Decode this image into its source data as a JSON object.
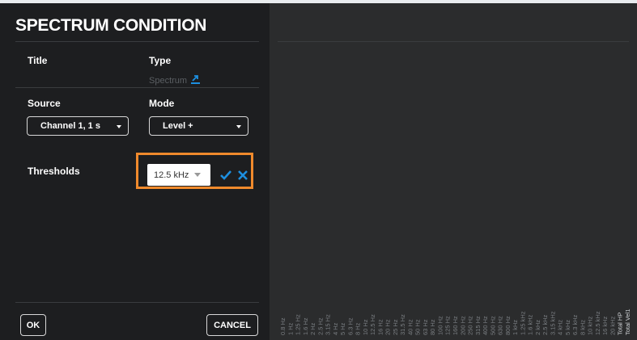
{
  "panel": {
    "title": "SPECTRUM CONDITION",
    "title_label": "Title",
    "type_label": "Type",
    "type_value": "Spectrum",
    "source_label": "Source",
    "mode_label": "Mode",
    "source_value": "Channel 1, 1 s",
    "mode_value": "Level +",
    "thresholds_label": "Thresholds",
    "threshold_value": "12.5 kHz",
    "ok_label": "OK",
    "cancel_label": "CANCEL"
  },
  "colors": {
    "highlight": "#f08a2c",
    "accent": "#1d8fe0",
    "panel_bg": "#1d1e20",
    "chart_bg": "#2b2c2d"
  },
  "icons": {
    "type_link": "external-link-icon",
    "confirm": "check-icon",
    "clear": "x-icon"
  },
  "chart": {
    "freq_labels": [
      "0.8 Hz",
      "1 Hz",
      "1.25 Hz",
      "1.6 Hz",
      "2 Hz",
      "2.5 Hz",
      "3.15 Hz",
      "4 Hz",
      "5 Hz",
      "6.3 Hz",
      "8 Hz",
      "10 Hz",
      "12.5 Hz",
      "16 Hz",
      "20 Hz",
      "25 Hz",
      "31.5 Hz",
      "40 Hz",
      "50 Hz",
      "63 Hz",
      "80 Hz",
      "100 Hz",
      "125 Hz",
      "160 Hz",
      "200 Hz",
      "250 Hz",
      "315 Hz",
      "400 Hz",
      "500 Hz",
      "630 Hz",
      "800 Hz",
      "1 kHz",
      "1.25 kHz",
      "1.6 kHz",
      "2 kHz",
      "2.5 kHz",
      "3.15 kHz",
      "4 kHz",
      "5 kHz",
      "6.3 kHz",
      "8 kHz",
      "10 kHz",
      "12.5 kHz",
      "16 kHz",
      "20 kHz",
      "Total HP",
      "Total Vel1"
    ]
  }
}
